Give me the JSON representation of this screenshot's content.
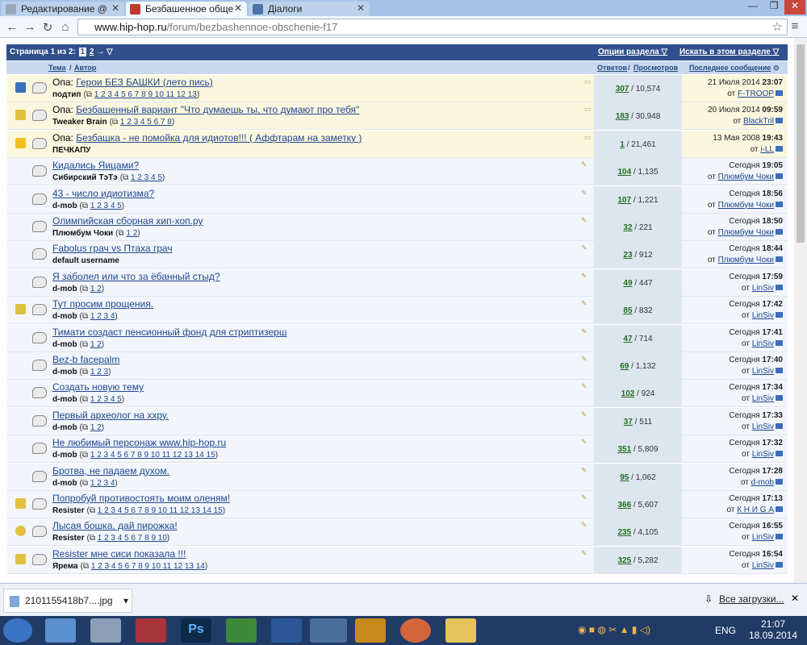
{
  "browser": {
    "tabs": [
      {
        "label": "Редактирование @",
        "active": false,
        "favicon": "edit-icon"
      },
      {
        "label": "Безбашенное обще",
        "active": true,
        "favicon": "hiphop-icon"
      },
      {
        "label": "Діалоги",
        "active": false,
        "favicon": "vk-icon"
      }
    ],
    "url_host": "www.hip-hop.ru",
    "url_path": "/forum/bezbashennoe-obschenie-f17"
  },
  "forum": {
    "page_text": "Страница 1 из 2:",
    "page_current": "1",
    "page_next": "2",
    "section_options": "Опции раздела",
    "search_section": "Искать в этом разделе",
    "col_topic": "Тема",
    "col_author": "Автор",
    "col_replies": "Ответов",
    "col_views": "Просмотров",
    "col_last": "Последнее сообщение",
    "threads": [
      {
        "prefix": "Опа:",
        "title": "Герои БЕЗ БАШКИ (лето пись)",
        "author": "подтип",
        "pages": "1 2 3 4 5 6 7 8 9 10 11 12 13",
        "replies": "307",
        "views": "10,574",
        "last_date": "21 Июля 2014",
        "last_time": "23:07",
        "last_user": "F-TROOP"
      },
      {
        "prefix": "Опа:",
        "title": "Безбашенный вариант \"Что думаешь ты, что думают про тебя\"",
        "author": "Tweaker Brain",
        "pages": "1 2 3 4 5 6 7 8",
        "replies": "183",
        "views": "30,948",
        "last_date": "20 Июля 2014",
        "last_time": "09:59",
        "last_user": "BlackTril"
      },
      {
        "prefix": "Опа:",
        "title": "Безбашка - не помойка для идиотов!!! ( Аффтарам на заметку )",
        "author": "ПЕЧКАПУ",
        "pages": "",
        "replies": "1",
        "views": "21,461",
        "last_date": "13 Мая 2008",
        "last_time": "19:43",
        "last_user": "i-LL"
      },
      {
        "prefix": "",
        "title": "Кидались Яицами?",
        "author": "Сибирский ТэТэ",
        "pages": "1 2 3 4 5",
        "replies": "104",
        "views": "1,135",
        "last_date": "Сегодня",
        "last_time": "19:05",
        "last_user": "Плюмбум Чоки"
      },
      {
        "prefix": "",
        "title": "43 - число идиотизма?",
        "author": "d-mob",
        "pages": "1 2 3 4 5",
        "replies": "107",
        "views": "1,221",
        "last_date": "Сегодня",
        "last_time": "18:56",
        "last_user": "Плюмбум Чоки"
      },
      {
        "prefix": "",
        "title": "Олимпийская сборная хип-хоп.ру",
        "author": "Плюмбум Чоки",
        "pages": "1 2",
        "replies": "32",
        "views": "221",
        "last_date": "Сегодня",
        "last_time": "18:50",
        "last_user": "Плюмбум Чоки"
      },
      {
        "prefix": "",
        "title": "Fabolus грач vs Птаха грач",
        "author": "default username",
        "pages": "",
        "replies": "23",
        "views": "912",
        "last_date": "Сегодня",
        "last_time": "18:44",
        "last_user": "Плюмбум Чоки"
      },
      {
        "prefix": "",
        "title": "Я заболел или что за ёбанный стыд?",
        "author": "d-mob",
        "pages": "1 2",
        "replies": "49",
        "views": "447",
        "last_date": "Сегодня",
        "last_time": "17:59",
        "last_user": "LinSiv"
      },
      {
        "prefix": "",
        "title": "Тут просим прощения.",
        "author": "d-mob",
        "pages": "1 2 3 4",
        "replies": "85",
        "views": "832",
        "last_date": "Сегодня",
        "last_time": "17:42",
        "last_user": "LinSiv"
      },
      {
        "prefix": "",
        "title": "Тимати создаст пенсионный фонд для стриптизерш",
        "author": "d-mob",
        "pages": "1 2",
        "replies": "47",
        "views": "714",
        "last_date": "Сегодня",
        "last_time": "17:41",
        "last_user": "LinSiv"
      },
      {
        "prefix": "",
        "title": "Bez-b facepalm",
        "author": "d-mob",
        "pages": "1 2 3",
        "replies": "69",
        "views": "1,132",
        "last_date": "Сегодня",
        "last_time": "17:40",
        "last_user": "LinSiv"
      },
      {
        "prefix": "",
        "title": "Создать новую тему",
        "author": "d-mob",
        "pages": "1 2 3 4 5",
        "replies": "102",
        "views": "924",
        "last_date": "Сегодня",
        "last_time": "17:34",
        "last_user": "LinSiv"
      },
      {
        "prefix": "",
        "title": "Первый археолог на xxру.",
        "author": "d-mob",
        "pages": "1 2",
        "replies": "37",
        "views": "511",
        "last_date": "Сегодня",
        "last_time": "17:33",
        "last_user": "LinSiv"
      },
      {
        "prefix": "",
        "title": "Не любимый персонаж www.hip-hop.ru",
        "author": "d-mob",
        "pages": "1 2 3 4 5 6 7 8 9 10 11 12 13 14 15",
        "replies": "351",
        "views": "5,809",
        "last_date": "Сегодня",
        "last_time": "17:32",
        "last_user": "LinSiv"
      },
      {
        "prefix": "",
        "title": "Бротва, не падаем духом.",
        "author": "d-mob",
        "pages": "1 2 3 4",
        "replies": "95",
        "views": "1,062",
        "last_date": "Сегодня",
        "last_time": "17:28",
        "last_user": "d-mob"
      },
      {
        "prefix": "",
        "title": "Попробуй противостоять моим оленям!",
        "author": "Resister",
        "pages": "1 2 3 4 5 6 7 8 9 10 11 12 13 14 15",
        "replies": "366",
        "views": "5,607",
        "last_date": "Сегодня",
        "last_time": "17:13",
        "last_user": "К Н И G А"
      },
      {
        "prefix": "",
        "title": "Лысая бошка, дай пирожка!",
        "author": "Resister",
        "pages": "1 2 3 4 5 6 7 8 9 10",
        "replies": "235",
        "views": "4,105",
        "last_date": "Сегодня",
        "last_time": "16:55",
        "last_user": "LinSiv"
      },
      {
        "prefix": "",
        "title": "Resister мне сиси показала !!!",
        "author": "Ярема",
        "pages": "1 2 3 4 5 6 7 8 9 10 11 12 13 14",
        "replies": "325",
        "views": "5,282",
        "last_date": "Сегодня",
        "last_time": "16:54",
        "last_user": "LinSiv"
      }
    ]
  },
  "downloads": {
    "file": "2101155418b7....jpg",
    "all": "Все загрузки..."
  },
  "taskbar": {
    "lang": "ENG",
    "time": "21:07",
    "date": "18.09.2014"
  },
  "colors": {
    "header": "#304f8c",
    "link": "#20468f",
    "replies": "#1f6f1f"
  }
}
